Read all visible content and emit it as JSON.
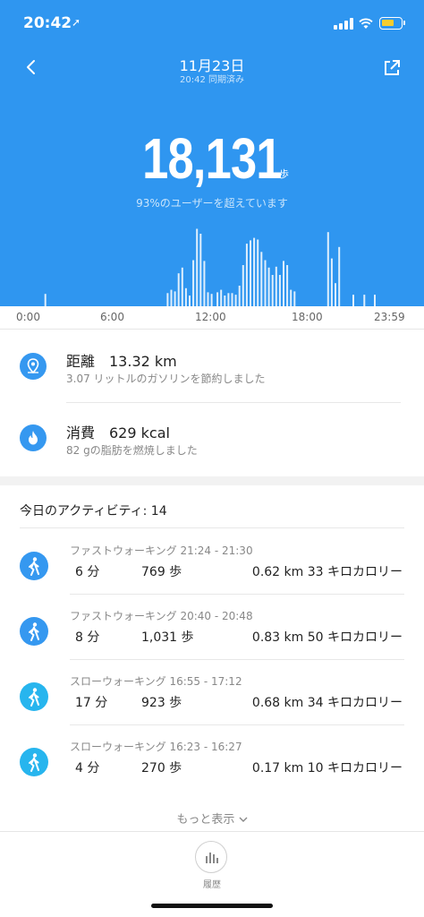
{
  "status_bar": {
    "time": "20:42",
    "location_arrow": "➚"
  },
  "header": {
    "date": "11月23日",
    "sync_text": "20:42 同期済み"
  },
  "summary": {
    "steps": "18,131",
    "steps_unit": "歩",
    "percent_text": "93%のユーザーを超えています"
  },
  "timeline": {
    "labels": [
      "0:00",
      "6:00",
      "12:00",
      "18:00",
      "23:59"
    ]
  },
  "metrics": [
    {
      "title": "距離　13.32 km",
      "sub": "3.07 リットルのガソリンを節約しました",
      "icon": "location-pin-icon"
    },
    {
      "title": "消費　629 kcal",
      "sub": "82 gの脂肪を燃焼しました",
      "icon": "flame-icon"
    }
  ],
  "activity_header": "今日のアクティビティ: 14",
  "activities": [
    {
      "label": "ファストウォーキング 21:24 - 21:30",
      "duration": "6 分",
      "steps": "769 歩",
      "stats": "0.62 km 33 キロカロリー",
      "icon": "fast-walk-icon",
      "color": "#3598f0"
    },
    {
      "label": "ファストウォーキング 20:40 - 20:48",
      "duration": "8 分",
      "steps": "1,031 歩",
      "stats": "0.83 km 50 キロカロリー",
      "icon": "fast-walk-icon",
      "color": "#3598f0"
    },
    {
      "label": "スローウォーキング 16:55 - 17:12",
      "duration": "17 分",
      "steps": "923 歩",
      "stats": "0.68 km 34 キロカロリー",
      "icon": "slow-walk-icon",
      "color": "#27b5ee"
    },
    {
      "label": "スローウォーキング 16:23 - 16:27",
      "duration": "4 分",
      "steps": "270 歩",
      "stats": "0.17 km 10 キロカロリー",
      "icon": "slow-walk-icon",
      "color": "#27b5ee"
    }
  ],
  "more_label": "もっと表示",
  "tabbar": {
    "history_label": "履歴"
  },
  "chart_data": {
    "type": "bar",
    "x_range": [
      "0:00",
      "23:59"
    ],
    "values": [
      {
        "x": "1:14",
        "v": 0.15
      },
      {
        "x": "9:00",
        "v": 0.16
      },
      {
        "x": "9:14",
        "v": 0.2
      },
      {
        "x": "9:28",
        "v": 0.18
      },
      {
        "x": "9:42",
        "v": 0.4
      },
      {
        "x": "9:56",
        "v": 0.47
      },
      {
        "x": "10:10",
        "v": 0.22
      },
      {
        "x": "10:24",
        "v": 0.13
      },
      {
        "x": "10:38",
        "v": 0.56
      },
      {
        "x": "10:52",
        "v": 0.94
      },
      {
        "x": "11:06",
        "v": 0.88
      },
      {
        "x": "11:20",
        "v": 0.55
      },
      {
        "x": "11:34",
        "v": 0.17
      },
      {
        "x": "11:48",
        "v": 0.15
      },
      {
        "x": "12:10",
        "v": 0.17
      },
      {
        "x": "12:24",
        "v": 0.2
      },
      {
        "x": "12:38",
        "v": 0.13
      },
      {
        "x": "12:52",
        "v": 0.16
      },
      {
        "x": "13:06",
        "v": 0.16
      },
      {
        "x": "13:20",
        "v": 0.14
      },
      {
        "x": "13:34",
        "v": 0.25
      },
      {
        "x": "13:48",
        "v": 0.5
      },
      {
        "x": "14:02",
        "v": 0.76
      },
      {
        "x": "14:16",
        "v": 0.8
      },
      {
        "x": "14:30",
        "v": 0.83
      },
      {
        "x": "14:44",
        "v": 0.81
      },
      {
        "x": "14:58",
        "v": 0.66
      },
      {
        "x": "15:12",
        "v": 0.56
      },
      {
        "x": "15:26",
        "v": 0.47
      },
      {
        "x": "15:40",
        "v": 0.38
      },
      {
        "x": "15:54",
        "v": 0.48
      },
      {
        "x": "16:08",
        "v": 0.38
      },
      {
        "x": "16:22",
        "v": 0.55
      },
      {
        "x": "16:36",
        "v": 0.5
      },
      {
        "x": "16:50",
        "v": 0.2
      },
      {
        "x": "17:04",
        "v": 0.18
      },
      {
        "x": "19:12",
        "v": 0.9
      },
      {
        "x": "19:26",
        "v": 0.58
      },
      {
        "x": "19:40",
        "v": 0.28
      },
      {
        "x": "19:54",
        "v": 0.72
      },
      {
        "x": "20:48",
        "v": 0.14
      },
      {
        "x": "21:30",
        "v": 0.14
      },
      {
        "x": "22:10",
        "v": 0.14
      }
    ]
  }
}
